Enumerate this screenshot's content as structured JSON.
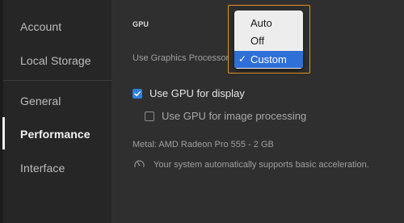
{
  "sidebar": {
    "items": [
      {
        "label": "Account"
      },
      {
        "label": "Local Storage"
      },
      {
        "label": "General"
      },
      {
        "label": "Performance"
      },
      {
        "label": "Interface"
      }
    ]
  },
  "gpu": {
    "section_title": "GPU",
    "processor_label": "Use Graphics Processor",
    "dropdown": {
      "options": [
        "Auto",
        "Off",
        "Custom"
      ],
      "selected": "Custom"
    },
    "display_label": "Use GPU for display",
    "display_checked": true,
    "image_processing_label": "Use GPU for image processing",
    "image_processing_checked": false,
    "metal_info": "Metal: AMD Radeon Pro 555 - 2 GB",
    "acceleration_info": "Your system automatically supports basic acceleration."
  },
  "colors": {
    "accent": "#2e7fe0",
    "highlight": "#e89020"
  }
}
